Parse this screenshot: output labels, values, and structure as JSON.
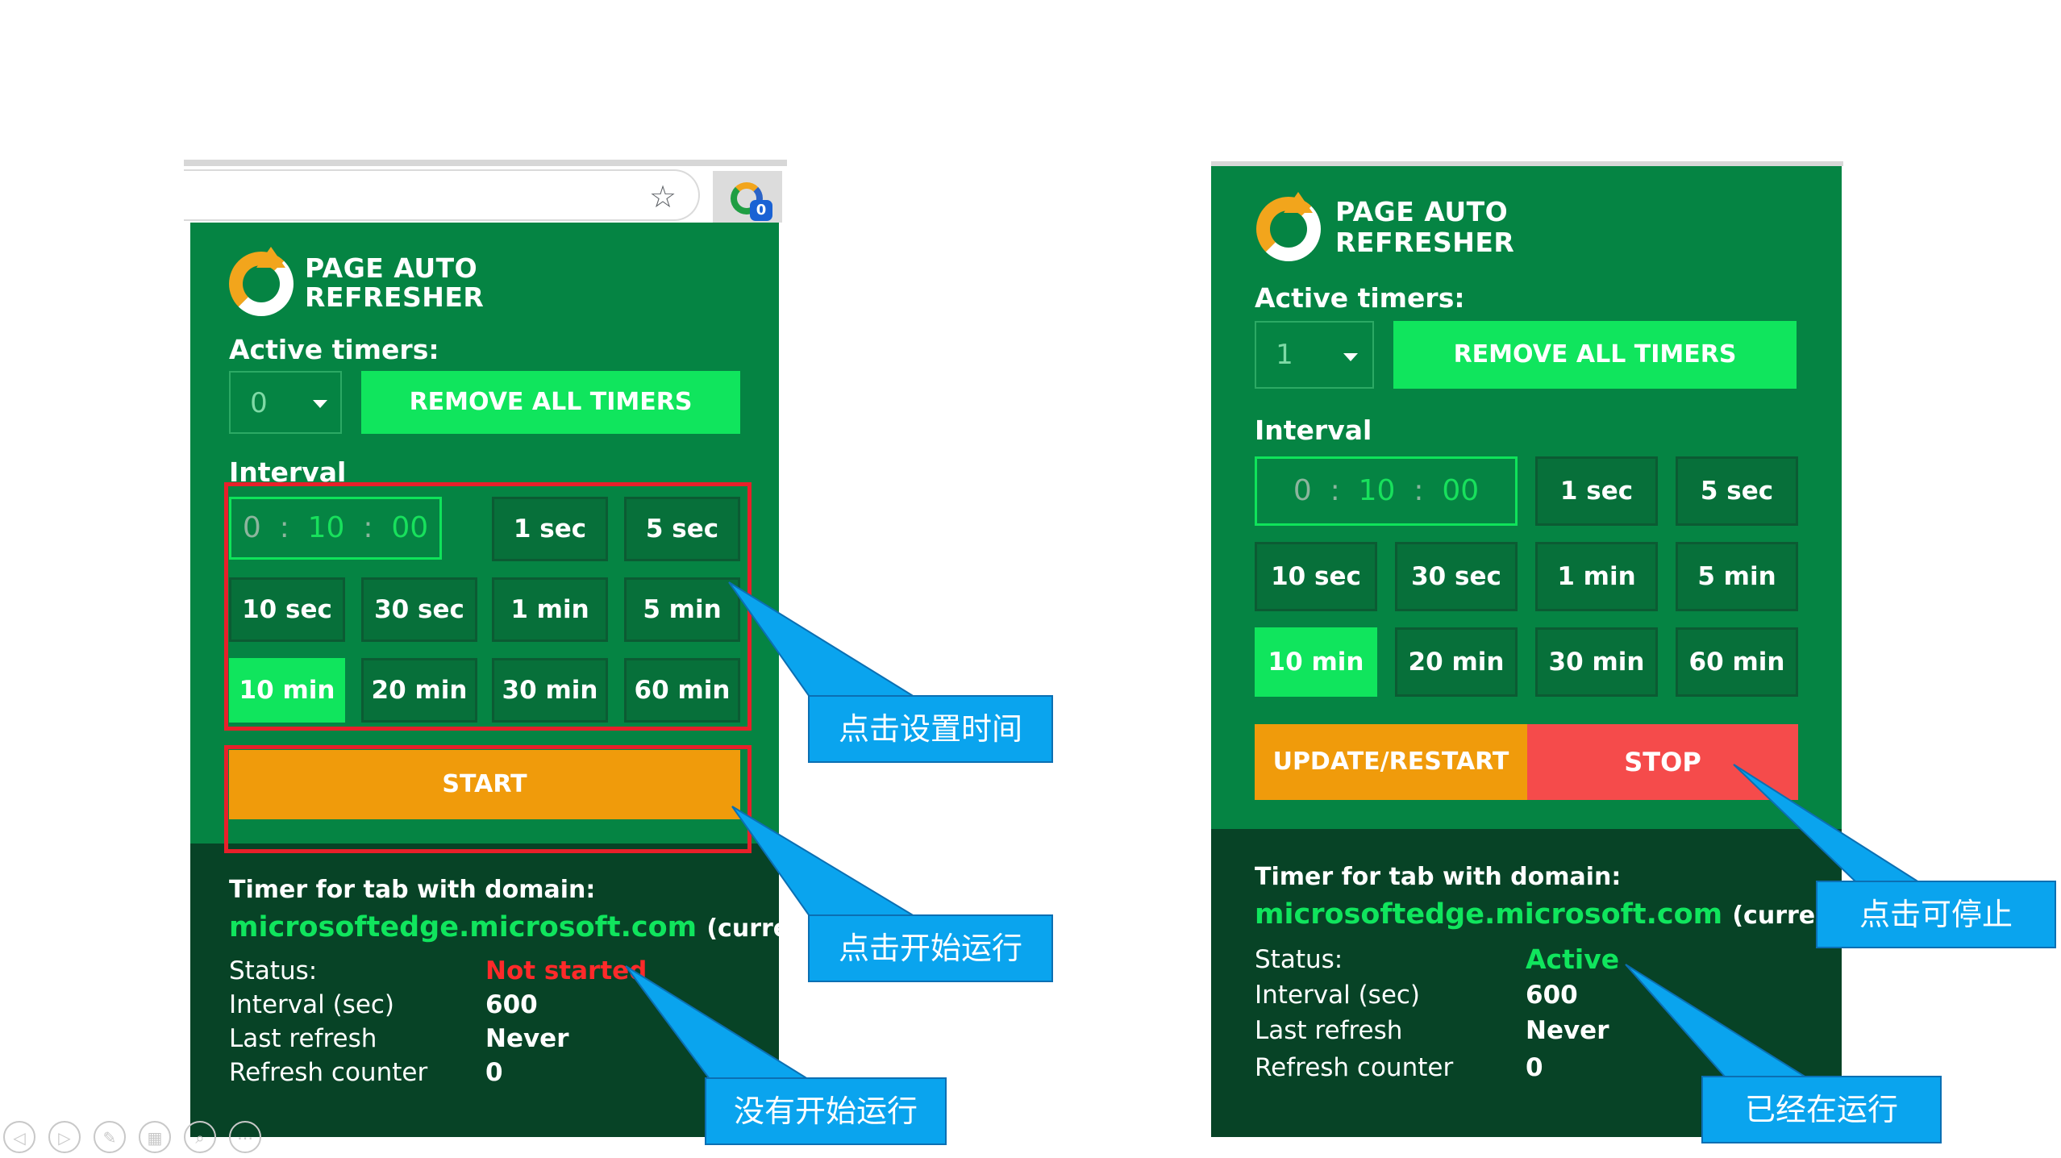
{
  "browser": {
    "star_icon": "star-icon",
    "extension_icon": "page-auto-refresher-icon",
    "extension_badge": "0"
  },
  "left_popup": {
    "brand_line1": "PAGE AUTO",
    "brand_line2": "REFRESHER",
    "active_timers_label": "Active timers:",
    "active_timers_value": "0",
    "remove_all_label": "REMOVE ALL TIMERS",
    "interval_label": "Interval",
    "time": {
      "hours": "0",
      "sep1": ":",
      "minutes": "10",
      "sep2": ":",
      "seconds": "00"
    },
    "options": [
      "1 sec",
      "5 sec",
      "10 sec",
      "30 sec",
      "1 min",
      "5 min",
      "10 min",
      "20 min",
      "30 min",
      "60 min"
    ],
    "selected_option": "10 min",
    "start_label": "START",
    "timer_title": "Timer for tab with domain:",
    "domain": "microsoftedge.microsoft.com",
    "domain_suffix": "(current...",
    "status_label": "Status:",
    "status_value": "Not started",
    "interval_sec_label": "Interval (sec)",
    "interval_sec_value": "600",
    "last_refresh_label": "Last refresh",
    "last_refresh_value": "Never",
    "counter_label": "Refresh counter",
    "counter_value": "0"
  },
  "right_popup": {
    "brand_line1": "PAGE AUTO",
    "brand_line2": "REFRESHER",
    "active_timers_label": "Active timers:",
    "active_timers_value": "1",
    "remove_all_label": "REMOVE ALL TIMERS",
    "interval_label": "Interval",
    "time": {
      "hours": "0",
      "sep1": ":",
      "minutes": "10",
      "sep2": ":",
      "seconds": "00"
    },
    "options": [
      "1 sec",
      "5 sec",
      "10 sec",
      "30 sec",
      "1 min",
      "5 min",
      "10 min",
      "20 min",
      "30 min",
      "60 min"
    ],
    "selected_option": "10 min",
    "update_label": "UPDATE/RESTART",
    "stop_label": "STOP",
    "timer_title": "Timer for tab with domain:",
    "domain": "microsoftedge.microsoft.com",
    "domain_suffix": "(current...",
    "status_label": "Status:",
    "status_value": "Active",
    "interval_sec_label": "Interval (sec)",
    "interval_sec_value": "600",
    "last_refresh_label": "Last refresh",
    "last_refresh_value": "Never",
    "counter_label": "Refresh counter",
    "counter_value": "0"
  },
  "callouts": {
    "set_time": "点击设置时间",
    "start_run": "点击开始运行",
    "not_started": "没有开始运行",
    "can_stop": "点击可停止",
    "running": "已经在运行"
  },
  "colors": {
    "popup_green": "#058443",
    "popup_dark": "#074326",
    "accent_green": "#10e55d",
    "start_orange": "#f09b0b",
    "stop_red": "#f54b4b",
    "callout_blue": "#0aa4ee",
    "highlight_red": "#e8202a"
  }
}
